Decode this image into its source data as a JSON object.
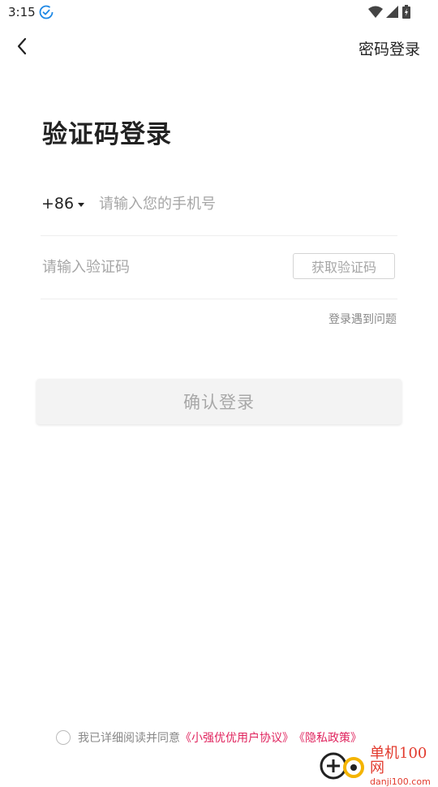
{
  "status_bar": {
    "time": "3:15"
  },
  "header": {
    "password_login": "密码登录"
  },
  "title": "验证码登录",
  "phone": {
    "country_code": "+86",
    "placeholder": "请输入您的手机号"
  },
  "code": {
    "placeholder": "请输入验证码",
    "get_code_label": "获取验证码"
  },
  "trouble_link": "登录遇到问题",
  "confirm_label": "确认登录",
  "agreement": {
    "prefix": "我已详细阅读并同意",
    "user_agreement": "《小强优优用户协议》",
    "privacy_policy": "《隐私政策》"
  },
  "watermark": {
    "title": "单机100网",
    "url": "danji100.com"
  },
  "colors": {
    "link": "#e0245e",
    "accent_check": "#1e88e5",
    "watermark": "#e23b2e"
  },
  "icons": [
    "sync-check-icon",
    "wifi-icon",
    "signal-icon",
    "battery-icon",
    "back-arrow-icon",
    "caret-down-icon"
  ]
}
